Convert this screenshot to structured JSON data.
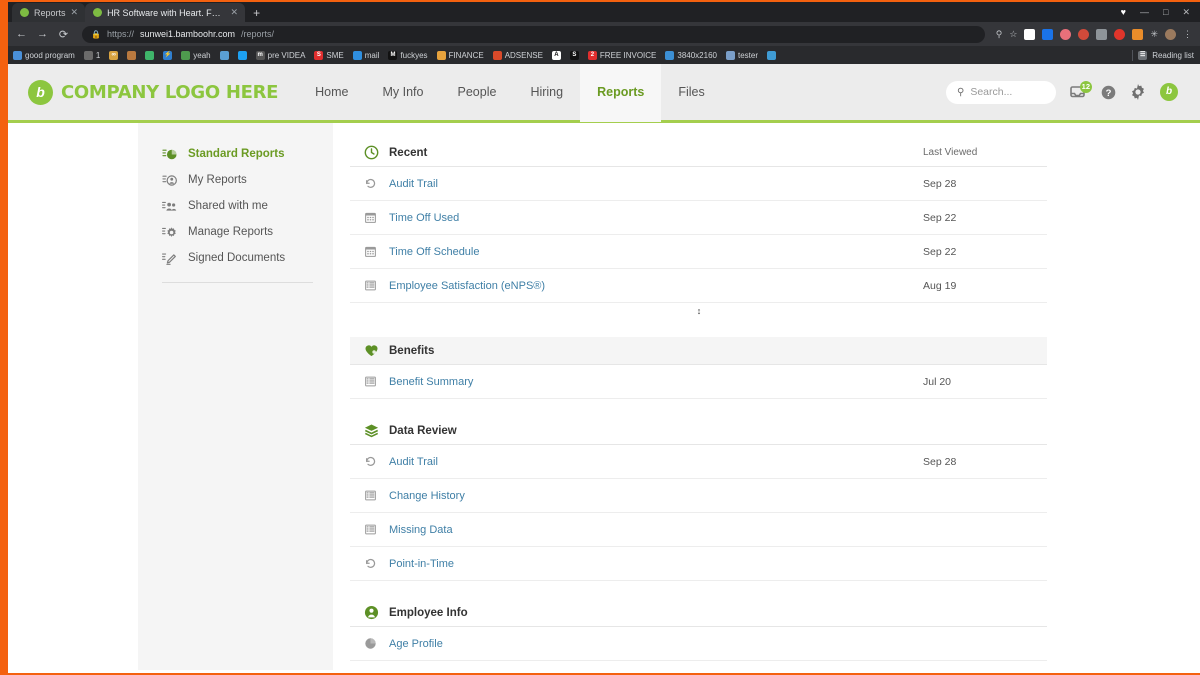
{
  "browser": {
    "tabs": [
      {
        "title": "Reports",
        "close": "✕"
      },
      {
        "title": "HR Software with Heart. Focus o",
        "close": "✕"
      }
    ],
    "new_tab": "+",
    "window_controls": {
      "heart": "♥",
      "minimize": "—",
      "maximize": "□",
      "close": "✕"
    },
    "nav": {
      "back": "←",
      "forward": "→",
      "reload": "⟳"
    },
    "omnibox": {
      "lock": "🔒",
      "scheme": "https://",
      "host": "sunwei1.bamboohr.com",
      "path": "/reports/"
    },
    "toolbar_icons": [
      "zoom-icon",
      "star-icon",
      "video-extension",
      "shield-extension",
      "heart-extension",
      "recorder-extension",
      "capture-extension",
      "media-extension",
      "fox-extension",
      "puzzle-extension",
      "profile-avatar",
      "menu-icon"
    ],
    "bookmarks": [
      {
        "label": "good program",
        "color": "#4a90d9",
        "glyph": ""
      },
      {
        "label": "1",
        "color": "#6b6b6b",
        "glyph": ""
      },
      {
        "label": "",
        "color": "#d9a441",
        "glyph": "∞"
      },
      {
        "label": "",
        "color": "#b9793f",
        "glyph": ""
      },
      {
        "label": "",
        "color": "#3fb56a",
        "glyph": ""
      },
      {
        "label": "",
        "color": "#2f7fd0",
        "glyph": "⚡"
      },
      {
        "label": "yeah",
        "color": "#4e9b4e",
        "glyph": ""
      },
      {
        "label": "",
        "color": "#5a9fd4",
        "glyph": ""
      },
      {
        "label": "",
        "color": "#1da1f2",
        "glyph": ""
      },
      {
        "label": "pre VIDEA",
        "color": "#555555",
        "glyph": "m"
      },
      {
        "label": "SME",
        "color": "#e02e2e",
        "glyph": "S"
      },
      {
        "label": "mail",
        "color": "#2f8fe0",
        "glyph": ""
      },
      {
        "label": "fuckyes",
        "color": "#111111",
        "glyph": "M"
      },
      {
        "label": "FINANCE",
        "color": "#e8a33d",
        "glyph": ""
      },
      {
        "label": "ADSENSE",
        "color": "#d94a2a",
        "glyph": ""
      },
      {
        "label": "",
        "color": "#ffffff",
        "glyph": "A"
      },
      {
        "label": "",
        "color": "#111111",
        "glyph": "S"
      },
      {
        "label": "FREE INVOICE",
        "color": "#e02e2e",
        "glyph": "2"
      },
      {
        "label": "3840x2160",
        "color": "#3c8fd4",
        "glyph": ""
      },
      {
        "label": "tester",
        "color": "#7a9ec8",
        "glyph": ""
      },
      {
        "label": "",
        "color": "#3f9bd4",
        "glyph": ""
      }
    ],
    "reading_list": "Reading list"
  },
  "app": {
    "logo": {
      "mark": "b",
      "text": "COMPANY LOGO HERE"
    },
    "nav_items": [
      {
        "label": "Home",
        "active": false
      },
      {
        "label": "My Info",
        "active": false
      },
      {
        "label": "People",
        "active": false
      },
      {
        "label": "Hiring",
        "active": false
      },
      {
        "label": "Reports",
        "active": true
      },
      {
        "label": "Files",
        "active": false
      }
    ],
    "search_placeholder": "Search...",
    "inbox_badge": "12",
    "help_glyph": "?",
    "avatar_letter": "b",
    "accent_green": "#8cc63f",
    "link_blue": "#3f7fa6"
  },
  "sidebar": {
    "items": [
      {
        "label": "Standard Reports",
        "icon": "pie-chart-icon",
        "active": true
      },
      {
        "label": "My Reports",
        "icon": "person-list-icon",
        "active": false
      },
      {
        "label": "Shared with me",
        "icon": "people-group-icon",
        "active": false
      },
      {
        "label": "Manage Reports",
        "icon": "gear-list-icon",
        "active": false
      },
      {
        "label": "Signed Documents",
        "icon": "signature-icon",
        "active": false
      }
    ]
  },
  "main": {
    "collapse_control": "↕",
    "sections": [
      {
        "title": "Recent",
        "icon": "clock-icon",
        "shaded": false,
        "meta": "Last Viewed",
        "rows": [
          {
            "label": "Audit Trail",
            "icon": "history-icon",
            "date": "Sep 28"
          },
          {
            "label": "Time Off Used",
            "icon": "calendar-icon",
            "date": "Sep 22"
          },
          {
            "label": "Time Off Schedule",
            "icon": "calendar-icon",
            "date": "Sep 22"
          },
          {
            "label": "Employee Satisfaction (eNPS®)",
            "icon": "table-icon",
            "date": "Aug 19"
          }
        ]
      },
      {
        "title": "Benefits",
        "icon": "heart-icon",
        "shaded": true,
        "meta": "",
        "rows": [
          {
            "label": "Benefit Summary",
            "icon": "table-icon",
            "date": "Jul 20"
          }
        ]
      },
      {
        "title": "Data Review",
        "icon": "layers-icon",
        "shaded": false,
        "meta": "",
        "rows": [
          {
            "label": "Audit Trail",
            "icon": "history-icon",
            "date": "Sep 28"
          },
          {
            "label": "Change History",
            "icon": "table-icon",
            "date": ""
          },
          {
            "label": "Missing Data",
            "icon": "table-icon",
            "date": ""
          },
          {
            "label": "Point-in-Time",
            "icon": "history-icon",
            "date": ""
          }
        ]
      },
      {
        "title": "Employee Info",
        "icon": "person-icon",
        "shaded": false,
        "meta": "",
        "rows": [
          {
            "label": "Age Profile",
            "icon": "pie-icon",
            "date": ""
          }
        ]
      }
    ]
  }
}
